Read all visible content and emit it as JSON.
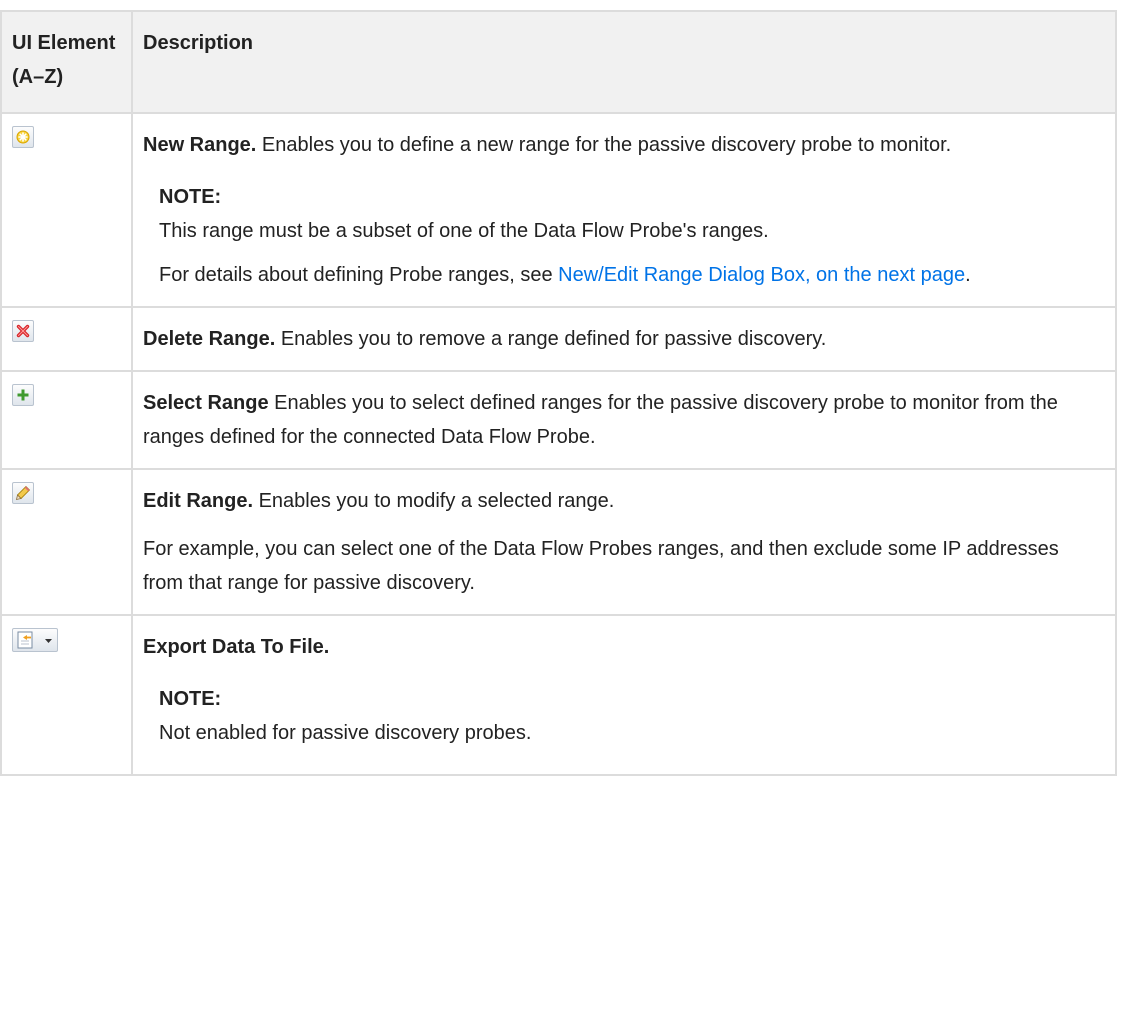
{
  "table": {
    "header": {
      "col1": "UI Element (A–Z)",
      "col2": "Description"
    },
    "rows": {
      "new_range": {
        "icon": "new-range-icon",
        "title": "New Range.",
        "text": " Enables you to define a new range for the passive discovery probe to monitor.",
        "note_title": "NOTE:",
        "note_text": "This range must be a subset of one of the Data Flow Probe's ranges.",
        "details_prefix": "For details about defining Probe ranges, see ",
        "details_link": "New/Edit Range Dialog Box, on the next page",
        "details_suffix": "."
      },
      "delete_range": {
        "icon": "delete-icon",
        "title": "Delete Range.",
        "text": " Enables you to remove a range defined for passive discovery."
      },
      "select_range": {
        "icon": "add-icon",
        "title": "Select Range",
        "text": " Enables you to select defined ranges for the passive discovery probe to monitor from the ranges defined for the connected Data Flow Probe."
      },
      "edit_range": {
        "icon": "pencil-icon",
        "title": "Edit Range.",
        "text": " Enables you to modify a selected range.",
        "example": "For example, you can select one of the Data Flow Probes ranges, and then exclude some IP addresses from that range for passive discovery."
      },
      "export_data": {
        "icon": "export-icon",
        "title": "Export Data To File.",
        "note_title": "NOTE:",
        "note_text": "Not enabled for passive discovery probes."
      }
    }
  },
  "colors": {
    "link": "#0073e7",
    "header_bg": "#f1f1f1",
    "border": "#dcdcdc"
  }
}
